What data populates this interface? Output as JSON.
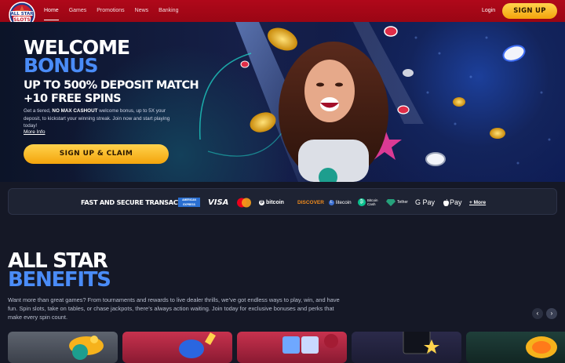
{
  "header": {
    "logo_text": "ALL STAR SLOTS",
    "nav": [
      "Home",
      "Games",
      "Promotions",
      "News",
      "Banking"
    ],
    "login": "Login",
    "signup": "SIGN UP"
  },
  "hero": {
    "title_line1": "WELCOME",
    "title_line2": "BONUS",
    "subtitle_line1": "UP TO 500% DEPOSIT MATCH",
    "subtitle_line2": "+10 FREE SPINS",
    "body_pre": "Get a tiered, ",
    "body_bold": "NO MAX CASHOUT",
    "body_post": " welcome bonus, up to 5X your deposit, to kickstart your winning streak. Join now and start playing today!",
    "more_info": "More Info",
    "cta": "SIGN UP & CLAIM"
  },
  "payments": {
    "title": "FAST AND SECURE TRANSACTIONS",
    "methods": {
      "amex": "AMERICAN EXPRESS",
      "visa": "VISA",
      "bitcoin": "bitcoin",
      "discover": "DISCOVER",
      "litecoin": "litecoin",
      "bitcoin_cash_1": "Bitcoin",
      "bitcoin_cash_2": "Cash",
      "tether": "Tether",
      "gpay": "G Pay",
      "applepay": "Pay"
    },
    "more": "+ More"
  },
  "benefits": {
    "title_line1": "ALL STAR",
    "title_line2": "BENEFITS",
    "body": "Want more than great games? From tournaments and rewards to live dealer thrills, we’ve got endless ways to play, win, and have fun. Spin slots, take on tables, or chase jackpots, there’s always action waiting. Join today for exclusive bonuses and perks that make every spin count.",
    "prev": "‹",
    "next": "›"
  },
  "colors": {
    "header_red": "#a80718",
    "accent_gold": "#f6b21c",
    "accent_blue": "#4a8cf7",
    "page_bg": "#151826"
  }
}
